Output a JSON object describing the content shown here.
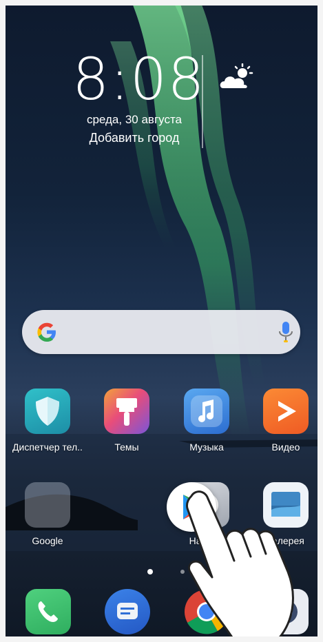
{
  "clock": {
    "time": "8:08",
    "date": "среда, 30 августа",
    "city_prompt": "Добавить город"
  },
  "weather": {
    "icon": "partly-cloudy-icon"
  },
  "search": {
    "logo": "google-g-icon",
    "voice_icon": "microphone-icon"
  },
  "apps_row1": [
    {
      "label": "Диспетчер тел..",
      "icon": "shield-icon",
      "color": "#2aa7b5"
    },
    {
      "label": "Темы",
      "icon": "paint-brush-icon",
      "color": "#e84d7a"
    },
    {
      "label": "Музыка",
      "icon": "music-note-icon",
      "color": "#3d8be0"
    },
    {
      "label": "Видео",
      "icon": "play-icon",
      "color": "#f5772a"
    }
  ],
  "apps_row2": [
    {
      "label": "Google",
      "icon": "folder-icon"
    },
    {
      "label": "Настр...",
      "icon": "settings-icon"
    },
    {
      "label": "Галерея",
      "icon": "gallery-icon",
      "color": "#3f88c5"
    }
  ],
  "dragged_app": {
    "icon": "play-store-icon"
  },
  "dock": [
    {
      "icon": "phone-icon",
      "color": "#3cbf6e"
    },
    {
      "icon": "messages-icon",
      "color": "#2f6fd6"
    },
    {
      "icon": "chrome-icon"
    },
    {
      "icon": "camera-icon"
    }
  ],
  "colors": {
    "search_bg": "#f0f0f5",
    "accent_green": "#3cbf6e"
  }
}
